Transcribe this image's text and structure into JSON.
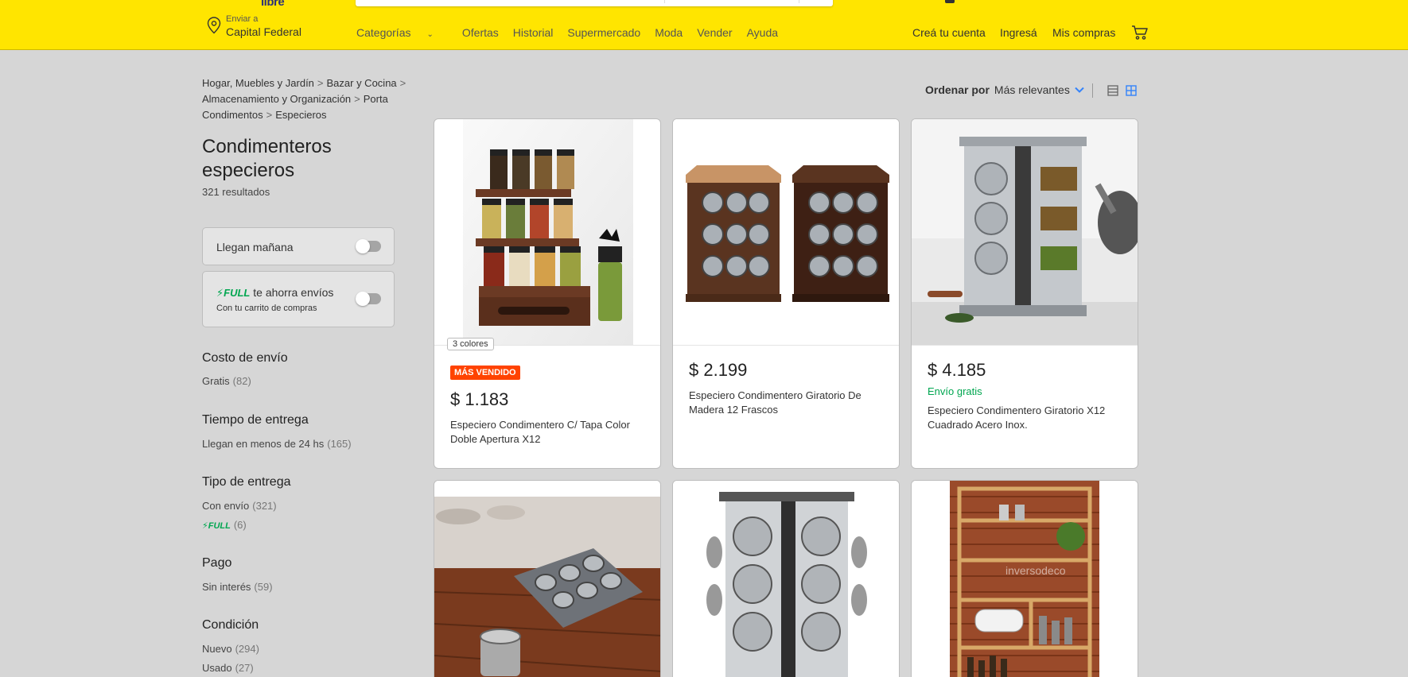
{
  "header": {
    "logo_fragment": "libre",
    "location": {
      "small": "Enviar a",
      "big": "Capital Federal"
    },
    "nav": [
      "Categorías",
      "Ofertas",
      "Historial",
      "Supermercado",
      "Moda",
      "Vender",
      "Ayuda"
    ],
    "right_links": [
      "Creá tu cuenta",
      "Ingresá",
      "Mis compras"
    ],
    "cart_icon": "cart-icon"
  },
  "breadcrumb": [
    "Hogar, Muebles y Jardín",
    "Bazar y Cocina",
    "Almacenamiento y Organización",
    "Porta Condimentos",
    "Especieros"
  ],
  "title": "Condimenteros especieros",
  "results": "321 resultados",
  "quick_filters": {
    "tomorrow": "Llegan mañana",
    "full_word": "FULL",
    "full_text": "te ahorra envíos",
    "full_sub": "Con tu carrito de compras"
  },
  "filters": [
    {
      "title": "Costo de envío",
      "items": [
        {
          "label": "Gratis",
          "count": "(82)"
        }
      ]
    },
    {
      "title": "Tiempo de entrega",
      "items": [
        {
          "label": "Llegan en menos de 24 hs",
          "count": "(165)"
        }
      ]
    },
    {
      "title": "Tipo de entrega",
      "items": [
        {
          "label": "Con envío",
          "count": "(321)"
        },
        {
          "label": "FULL",
          "count": "(6)"
        }
      ]
    },
    {
      "title": "Pago",
      "items": [
        {
          "label": "Sin interés",
          "count": "(59)"
        }
      ]
    },
    {
      "title": "Condición",
      "items": [
        {
          "label": "Nuevo",
          "count": "(294)"
        },
        {
          "label": "Usado",
          "count": "(27)"
        }
      ]
    }
  ],
  "sort": {
    "label": "Ordenar por",
    "value": "Más relevantes"
  },
  "products": [
    {
      "colors": "3 colores",
      "badge": "MÁS VENDIDO",
      "price": "$ 1.183",
      "title": "Especiero Condimentero C/ Tapa Color Doble Apertura X12"
    },
    {
      "price": "$ 2.199",
      "title": "Especiero Condimentero Giratorio De Madera 12 Frascos"
    },
    {
      "price": "$ 4.185",
      "shipping": "Envío gratis",
      "title": "Especiero Condimentero Giratorio X12 Cuadrado Acero Inox."
    },
    {},
    {},
    {
      "watermark": "inversodeco"
    }
  ],
  "colors": {
    "header_bg": "#ffe500",
    "accent_blue": "#3483fa",
    "full_green": "#00a650",
    "badge_orange": "#ff4300"
  }
}
